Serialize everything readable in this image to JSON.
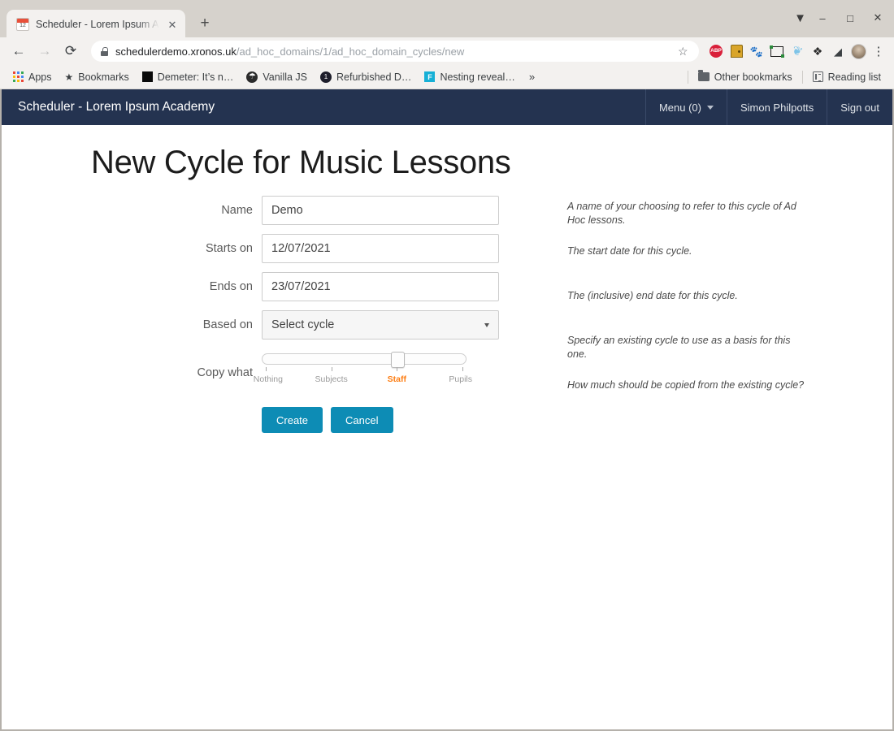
{
  "browser": {
    "tab": {
      "title": "Scheduler - Lorem Ipsum A",
      "favicon": "calendar-icon",
      "close": "✕",
      "new_tab": "+"
    },
    "window_controls": {
      "extra": "▼",
      "minimize": "–",
      "maximize": "□",
      "close": "✕"
    },
    "toolbar": {
      "back": "←",
      "forward": "→",
      "reload": "⟳",
      "url_domain": "schedulerdemo.xronos.uk",
      "url_path": "/ad_hoc_domains/1/ad_hoc_domain_cycles/new",
      "bookmark_star": "☆",
      "extensions": [
        {
          "name": "adblock-plus-icon",
          "label": "ABP"
        },
        {
          "name": "door-icon",
          "label": ""
        },
        {
          "name": "gnome-foot-icon",
          "label": "🐾"
        },
        {
          "name": "screenshot-frame-icon",
          "label": ""
        },
        {
          "name": "leaf-icon",
          "label": "❦"
        },
        {
          "name": "puzzle-icon",
          "label": "❖"
        },
        {
          "name": "cast-icon",
          "label": "◢"
        },
        {
          "name": "profile-avatar",
          "label": ""
        },
        {
          "name": "chrome-menu-icon",
          "label": "⋮"
        }
      ]
    },
    "bookmarks": {
      "left": [
        {
          "name": "apps-button",
          "label": "Apps",
          "icon": "apps-grid-icon"
        },
        {
          "name": "bookmarks-folder",
          "label": "Bookmarks",
          "icon": "star-icon"
        },
        {
          "name": "bookmark-demeter",
          "label": "Demeter: It’s n…",
          "icon": "black-square-icon"
        },
        {
          "name": "bookmark-vanilla-js",
          "label": "Vanilla JS",
          "icon": "globe-icon"
        },
        {
          "name": "bookmark-refurbished",
          "label": "Refurbished D…",
          "icon": "circle-one-icon"
        },
        {
          "name": "bookmark-nesting",
          "label": "Nesting reveal…",
          "icon": "teal-square-icon"
        }
      ],
      "overflow": "»",
      "other_bookmarks": "Other bookmarks",
      "reading_list": "Reading list"
    }
  },
  "app": {
    "navbar": {
      "brand": "Scheduler - Lorem Ipsum Academy",
      "menu": "Menu (0)",
      "user": "Simon Philpotts",
      "sign_out": "Sign out"
    },
    "page_title": "New Cycle for Music Lessons",
    "form": {
      "fields": [
        {
          "name": "name",
          "label": "Name",
          "value": "Demo",
          "type": "text",
          "help": "A name of your choosing to refer to this cycle of Ad Hoc lessons."
        },
        {
          "name": "starts-on",
          "label": "Starts on",
          "value": "12/07/2021",
          "type": "text",
          "help": "The start date for this cycle."
        },
        {
          "name": "ends-on",
          "label": "Ends on",
          "value": "23/07/2021",
          "type": "text",
          "help": "The (inclusive) end date for this cycle."
        },
        {
          "name": "based-on",
          "label": "Based on",
          "value": "Select cycle",
          "type": "select",
          "help": "Specify an existing cycle to use as a basis for this one."
        }
      ],
      "slider": {
        "label": "Copy what",
        "help": "How much should be copied from the existing cycle?",
        "options": [
          "Nothing",
          "Subjects",
          "Staff",
          "Pupils"
        ],
        "selected_index": 2,
        "selected": "Staff"
      },
      "buttons": {
        "submit": "Create",
        "cancel": "Cancel"
      }
    }
  },
  "colors": {
    "navbar_bg": "#243350",
    "button_bg": "#0d8cb5",
    "slider_active": "#fd7e14",
    "page_bg": "#ffffff",
    "chrome_bg": "#f3f1ef",
    "window_bg": "#d6d2cc"
  }
}
